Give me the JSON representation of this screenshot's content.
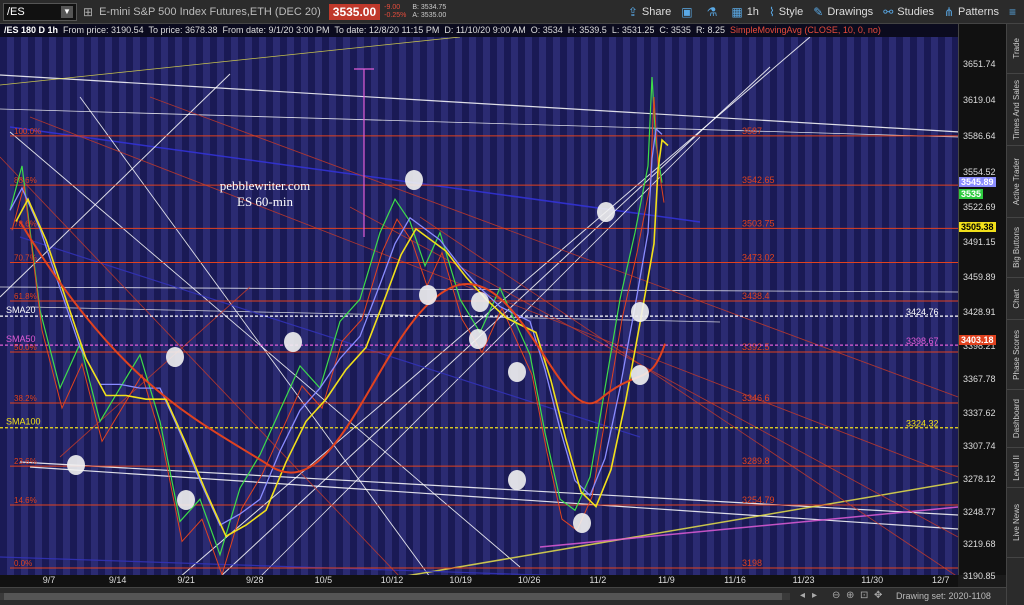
{
  "toolbar": {
    "symbol": "/ES",
    "description": "E-mini S&P 500 Index Futures,ETH (DEC 20)",
    "last_price": "3535.00",
    "change": "-9.00",
    "change_pct": "-0.25%",
    "bid": "B: 3534.75",
    "ask": "A: 3535.00",
    "share_label": "Share",
    "timeframe": "1h",
    "style_label": "Style",
    "drawings_label": "Drawings",
    "studies_label": "Studies",
    "patterns_label": "Patterns"
  },
  "info": {
    "title": "/ES 180 D 1h",
    "from_price": "From price: 3190.54",
    "to_price": "To price: 3678.38",
    "from_date": "From date: 9/1/20 3:00 PM",
    "to_date": "To date: 12/8/20 11:15 PM",
    "cursor_date": "D: 11/10/20 9:00 AM",
    "open": "O: 3534",
    "high": "H: 3539.5",
    "low": "L: 3531.25",
    "close": "C: 3535",
    "range": "R: 8.25",
    "sma_study": "SimpleMovingAvg (CLOSE, 10, 0, no)"
  },
  "watermark": {
    "line1": "pebblewriter.com",
    "line2": "ES 60-min"
  },
  "chart_data": {
    "type": "line",
    "price_range": [
      3190,
      3678
    ],
    "price_ticks": [
      "3651.74",
      "3619.04",
      "3586.64",
      "3554.52",
      "3522.69",
      "3491.15",
      "3459.89",
      "3428.91",
      "3398.21",
      "3367.78",
      "3337.62",
      "3307.74",
      "3278.12",
      "3248.77",
      "3219.68",
      "3190.85"
    ],
    "date_ticks": [
      "9/7",
      "9/14",
      "9/21",
      "9/28",
      "10/5",
      "10/12",
      "10/19",
      "10/26",
      "11/2",
      "11/9",
      "11/16",
      "11/23",
      "11/30",
      "12/7"
    ],
    "fib_levels": [
      {
        "label": "100.0%",
        "value": "3587"
      },
      {
        "label": "88.6%",
        "value": "3542.65"
      },
      {
        "label": "78.6%",
        "value": "3503.75"
      },
      {
        "label": "70.7%",
        "value": "3473.02"
      },
      {
        "label": "61.8%",
        "value": "3438.4"
      },
      {
        "label": "50.0%",
        "value": "3392.5"
      },
      {
        "label": "38.2%",
        "value": "3346.6"
      },
      {
        "label": "23.6%",
        "value": "3289.8"
      },
      {
        "label": "14.6%",
        "value": "3254.79"
      },
      {
        "label": "0.0%",
        "value": "3198"
      }
    ],
    "ma_labels": [
      {
        "name": "SMA20",
        "value": "3424.76"
      },
      {
        "name": "SMA50",
        "value": "3398.67"
      },
      {
        "name": "SMA100",
        "value": "3324.32"
      }
    ],
    "price_tags": [
      {
        "value": "3545.89",
        "color": "#8a8cff"
      },
      {
        "value": "3535",
        "color": "#2ecc40"
      },
      {
        "value": "3505.38",
        "color": "#f1e01a"
      },
      {
        "value": "3403.18",
        "color": "#e0421f"
      }
    ]
  },
  "sidebar": [
    "Trade",
    "Times And Sales",
    "Active Trader",
    "Big Buttons",
    "Chart",
    "Phase Scores",
    "Dashboard",
    "Level II",
    "Live News"
  ],
  "status": {
    "drawing_set": "Drawing set: 2020-1108"
  },
  "colors": {
    "bg_stripe_a": "#1a1a55",
    "bg_stripe_b": "#2b2b72",
    "fib": "#e0421f",
    "sma20": "#8a8cff",
    "sma50": "#e0421f",
    "sma100": "#f1e01a"
  }
}
